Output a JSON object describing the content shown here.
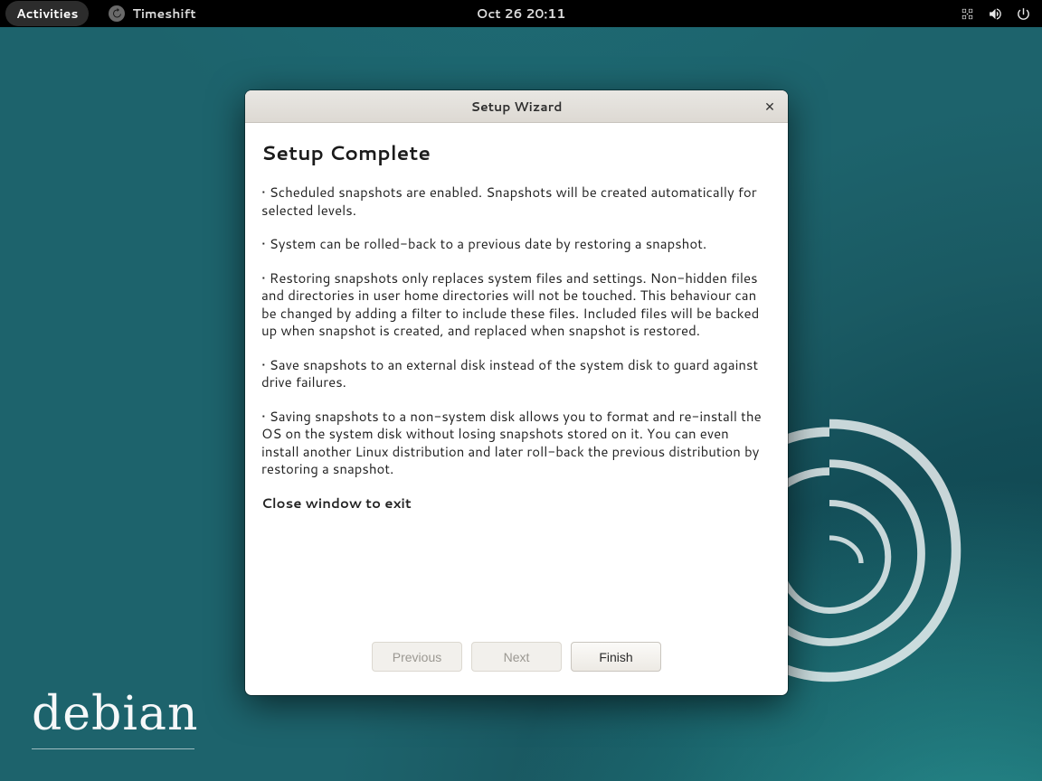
{
  "panel": {
    "activities": "Activities",
    "app_name": "Timeshift",
    "clock": "Oct 26  20:11"
  },
  "dialog": {
    "title": "Setup Wizard",
    "heading": "Setup Complete",
    "bullets": [
      "• Scheduled snapshots are enabled. Snapshots will be created automatically for selected levels.",
      "• System can be rolled-back to a previous date by restoring a snapshot.",
      "• Restoring snapshots only replaces system files and settings. Non-hidden files and directories in user home directories will not be touched. This behaviour can be changed by adding a filter to include these files. Included files will be backed up when snapshot is created, and replaced when snapshot is restored.",
      "• Save snapshots to an external disk instead of the system disk to guard against drive failures.",
      "• Saving snapshots to a non-system disk allows you to format and re-install the OS on the system disk without losing snapshots stored on it. You can even install another Linux distribution and later roll-back the previous distribution by restoring a snapshot."
    ],
    "footnote": "Close window to exit",
    "buttons": {
      "previous": "Previous",
      "next": "Next",
      "finish": "Finish"
    }
  },
  "brand": "debian"
}
